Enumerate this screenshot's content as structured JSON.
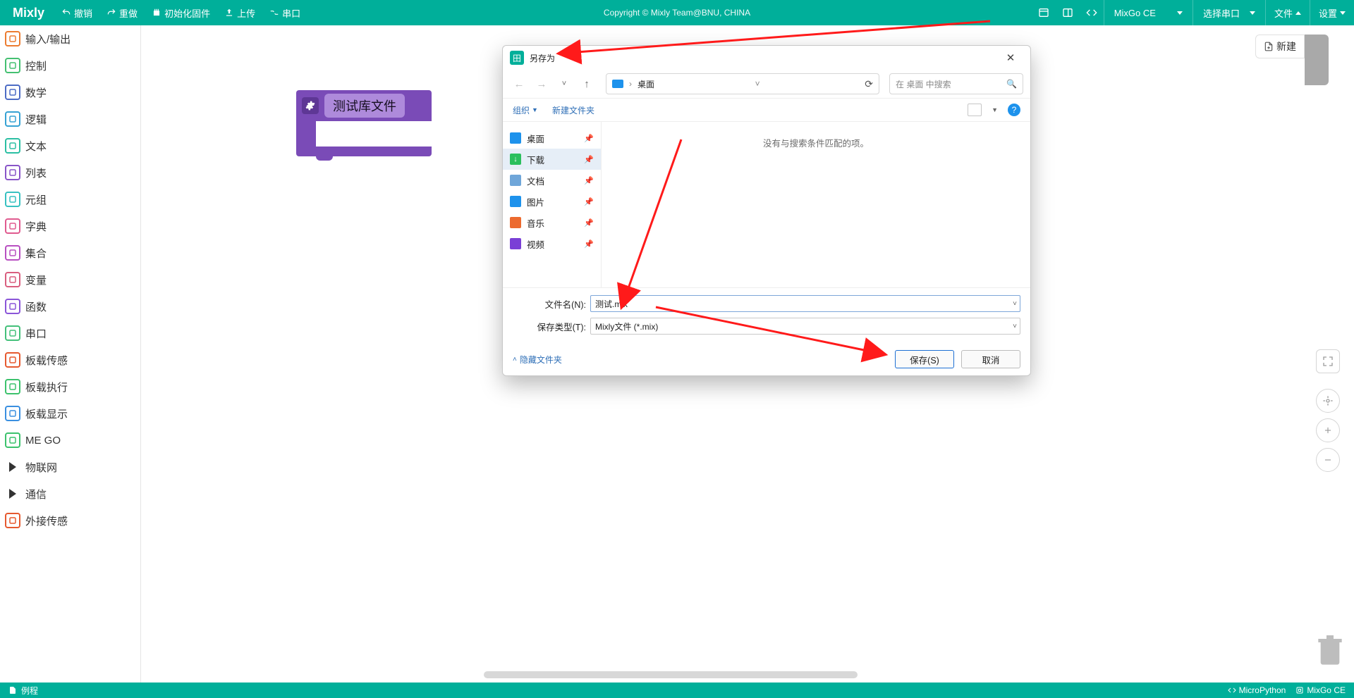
{
  "toolbar": {
    "logo": "Mixly",
    "undo": "撤销",
    "redo": "重做",
    "init": "初始化固件",
    "upload": "上传",
    "serial": "串口",
    "copyright": "Copyright © Mixly Team@BNU, CHINA",
    "board": "MixGo CE",
    "port": "选择串口",
    "file": "文件",
    "settings": "设置"
  },
  "categories": [
    {
      "label": "输入/输出",
      "color": "#ec7c30",
      "icon": "io"
    },
    {
      "label": "控制",
      "color": "#44c071",
      "icon": "ctrl"
    },
    {
      "label": "数学",
      "color": "#4d6cc5",
      "icon": "math"
    },
    {
      "label": "逻辑",
      "color": "#36a2d4",
      "icon": "logic"
    },
    {
      "label": "文本",
      "color": "#2bbfa3",
      "icon": "text"
    },
    {
      "label": "列表",
      "color": "#8955c8",
      "icon": "list"
    },
    {
      "label": "元组",
      "color": "#37c1c1",
      "icon": "tuple"
    },
    {
      "label": "字典",
      "color": "#e05a8f",
      "icon": "dict"
    },
    {
      "label": "集合",
      "color": "#b84fc1",
      "icon": "set"
    },
    {
      "label": "变量",
      "color": "#d95e7e",
      "icon": "var"
    },
    {
      "label": "函数",
      "color": "#8a55d8",
      "icon": "func"
    },
    {
      "label": "串口",
      "color": "#44c07a",
      "icon": "ser"
    },
    {
      "label": "板载传感",
      "color": "#e6592f",
      "icon": "sense"
    },
    {
      "label": "板载执行",
      "color": "#3cc26d",
      "icon": "act"
    },
    {
      "label": "板载显示",
      "color": "#3a8fe0",
      "icon": "disp"
    },
    {
      "label": "ME GO",
      "color": "#3cc26d",
      "icon": "mego"
    },
    {
      "label": "物联网",
      "color": "#333333",
      "icon": "iot",
      "tri": true
    },
    {
      "label": "通信",
      "color": "#333333",
      "icon": "comm",
      "tri": true
    },
    {
      "label": "外接传感",
      "color": "#e6592f",
      "icon": "ext"
    }
  ],
  "workspace": {
    "new_tab": "新建",
    "block_label": "测试库文件"
  },
  "dialog": {
    "title": "另存为",
    "breadcrumb": "桌面",
    "search_placeholder": "在 桌面 中搜索",
    "organize": "组织",
    "new_folder": "新建文件夹",
    "empty_hint": "没有与搜索条件匹配的项。",
    "quick": [
      {
        "label": "桌面",
        "color": "#1d92ec"
      },
      {
        "label": "下载",
        "color": "#2bbf5d",
        "selected": true,
        "glyph": "↓"
      },
      {
        "label": "文档",
        "color": "#6fa6d9"
      },
      {
        "label": "图片",
        "color": "#1d92ec"
      },
      {
        "label": "音乐",
        "color": "#ec6a2f"
      },
      {
        "label": "视频",
        "color": "#7a3fd6"
      }
    ],
    "filename_label": "文件名(N):",
    "filename_value": "测试.mix",
    "filetype_label": "保存类型(T):",
    "filetype_value": "Mixly文件 (*.mix)",
    "hide_folders": "隐藏文件夹",
    "save_btn": "保存(S)",
    "cancel_btn": "取消"
  },
  "status": {
    "example": "例程",
    "lang": "MicroPython",
    "board": "MixGo CE"
  }
}
